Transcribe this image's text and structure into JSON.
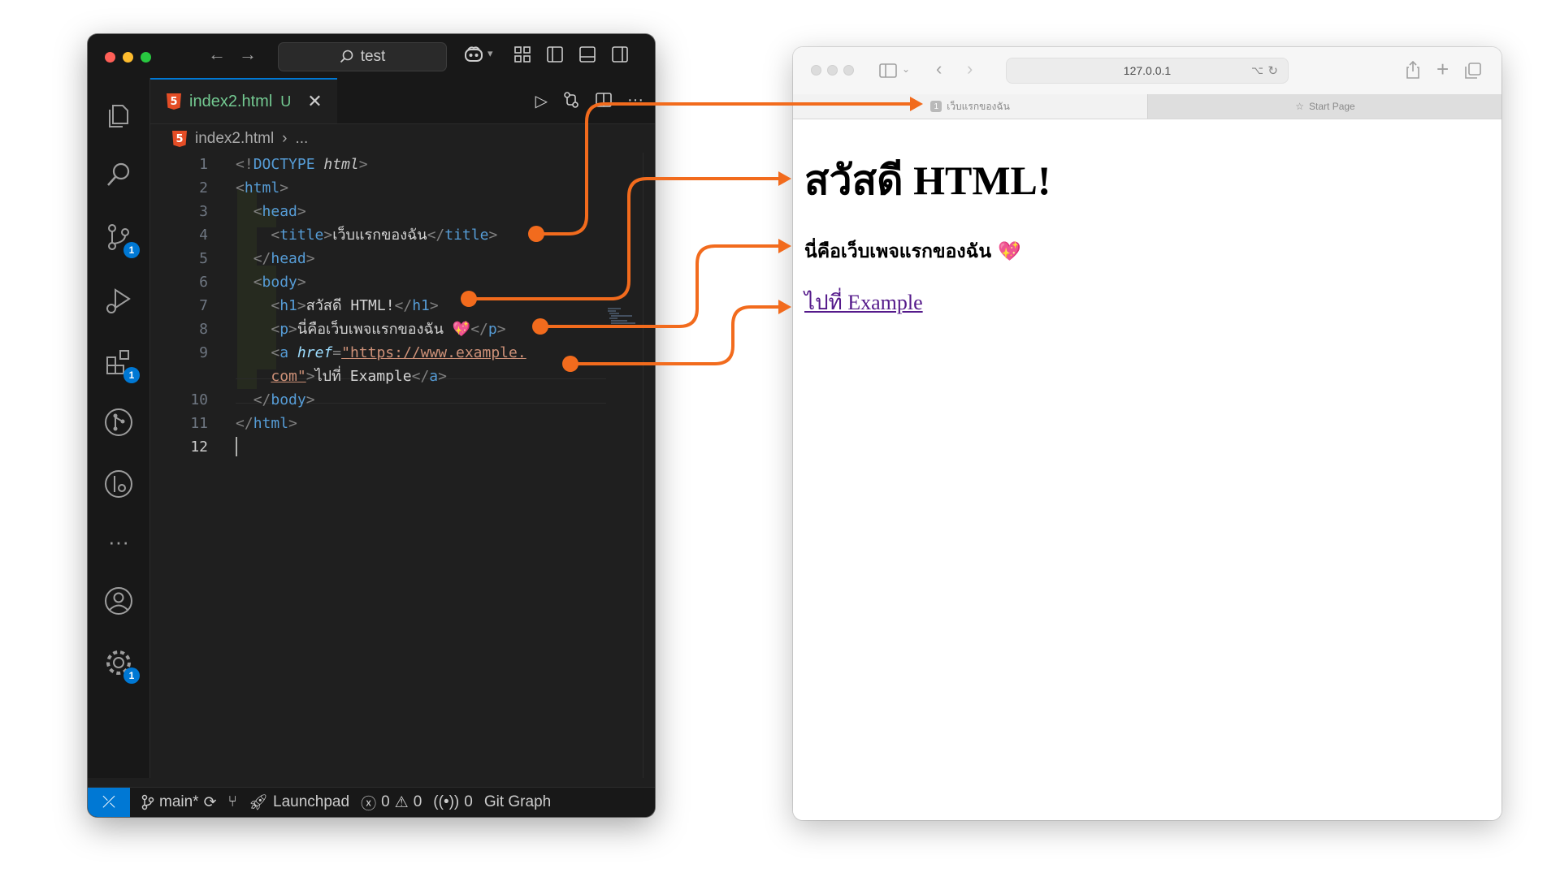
{
  "colors": {
    "accent": "#0078d4",
    "arrow": "#f26b1d",
    "tab_modified": "#73c991",
    "link_visited": "#551a8b"
  },
  "vscode": {
    "search_text": "test",
    "tab": {
      "filename": "index2.html",
      "status": "U"
    },
    "breadcrumb": {
      "file": "index2.html",
      "rest": "..."
    },
    "activity_badges": {
      "source_control": "1",
      "extensions": "1",
      "settings": "1"
    },
    "code_lines": [
      {
        "num": "1"
      },
      {
        "num": "2"
      },
      {
        "num": "3"
      },
      {
        "num": "4",
        "title_text": "เว็บแรกของฉัน"
      },
      {
        "num": "5"
      },
      {
        "num": "6"
      },
      {
        "num": "7",
        "h1_text": "สวัสดี HTML!"
      },
      {
        "num": "8",
        "p_text": "นี่คือเว็บเพจแรกของฉัน 💖"
      },
      {
        "num": "9",
        "href_part1": "https://www.example.",
        "href_part2": "com",
        "a_text": "ไปที่ Example"
      },
      {
        "num": "10"
      },
      {
        "num": "11"
      },
      {
        "num": "12"
      }
    ],
    "statusbar": {
      "branch": "main*",
      "launchpad": "Launchpad",
      "errors": "0",
      "warnings": "0",
      "ports": "0",
      "git_graph": "Git Graph"
    }
  },
  "safari": {
    "address": "127.0.0.1",
    "tab_active": "เว็บแรกของฉัน",
    "tab_inactive": "Start Page",
    "page": {
      "h1": "สวัสดี HTML!",
      "p": "นี่คือเว็บเพจแรกของฉัน 💖",
      "link": "ไปที่ Example"
    }
  }
}
